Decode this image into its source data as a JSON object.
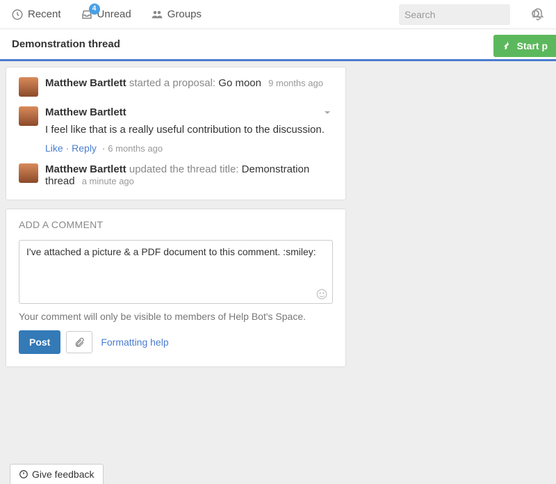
{
  "nav": {
    "recent": "Recent",
    "unread": "Unread",
    "unread_badge": "4",
    "groups": "Groups",
    "search_placeholder": "Search"
  },
  "thread": {
    "title": "Demonstration thread",
    "start_button": "Start p"
  },
  "activities": [
    {
      "author": "Matthew Bartlett",
      "action": "started a proposal:",
      "subject": "Go moon",
      "meta": "9 months ago"
    },
    {
      "author": "Matthew Bartlett",
      "body": "I feel like that is a really useful contribution to the discussion.",
      "like": "Like",
      "reply": "Reply",
      "meta": "6 months ago"
    },
    {
      "author": "Matthew Bartlett",
      "action": "updated the thread title:",
      "subject": "Demonstration thread",
      "meta": "a minute ago"
    }
  ],
  "comment_form": {
    "label": "ADD A COMMENT",
    "draft": "I've attached a picture & a PDF document to this comment. :smiley:",
    "visibility": "Your comment will only be visible to members of Help Bot's Space.",
    "post": "Post",
    "formatting_help": "Formatting help"
  },
  "feedback": "Give feedback"
}
